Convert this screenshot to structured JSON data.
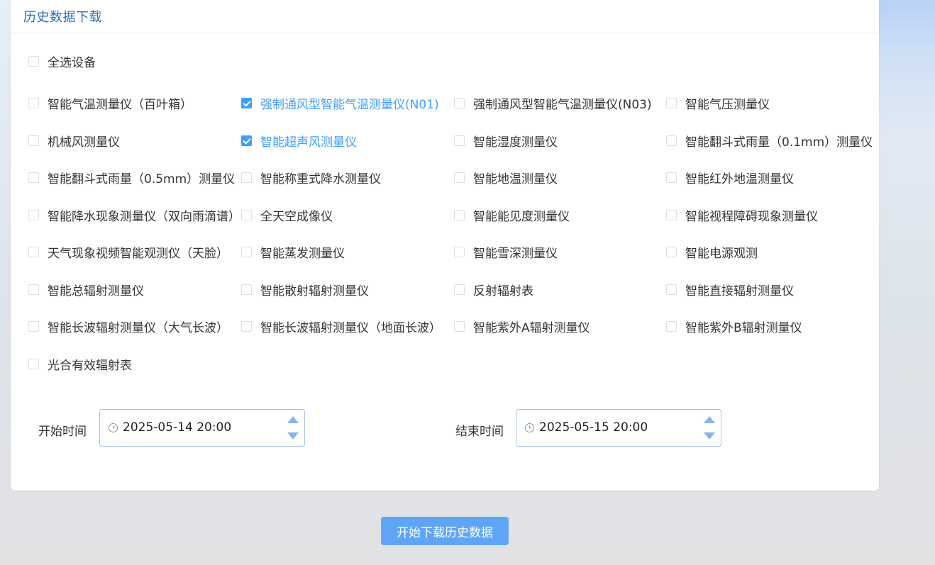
{
  "panel": {
    "title": "历史数据下载"
  },
  "select_all": {
    "label": "全选设备",
    "checked": false
  },
  "devices": [
    {
      "label": "智能气温测量仪（百叶箱）",
      "checked": false
    },
    {
      "label": "强制通风型智能气温测量仪(N01)",
      "checked": true
    },
    {
      "label": "强制通风型智能气温测量仪(N03)",
      "checked": false
    },
    {
      "label": "智能气压测量仪",
      "checked": false
    },
    {
      "label": "机械风测量仪",
      "checked": false
    },
    {
      "label": "智能超声风测量仪",
      "checked": true
    },
    {
      "label": "智能湿度测量仪",
      "checked": false
    },
    {
      "label": "智能翻斗式雨量（0.1mm）测量仪",
      "checked": false
    },
    {
      "label": "智能翻斗式雨量（0.5mm）测量仪",
      "checked": false
    },
    {
      "label": "智能称重式降水测量仪",
      "checked": false
    },
    {
      "label": "智能地温测量仪",
      "checked": false
    },
    {
      "label": "智能红外地温测量仪",
      "checked": false
    },
    {
      "label": "智能降水现象测量仪（双向雨滴谱）",
      "checked": false
    },
    {
      "label": "全天空成像仪",
      "checked": false
    },
    {
      "label": "智能能见度测量仪",
      "checked": false
    },
    {
      "label": "智能视程障碍现象测量仪",
      "checked": false
    },
    {
      "label": "天气现象视频智能观测仪（天脸）",
      "checked": false
    },
    {
      "label": "智能蒸发测量仪",
      "checked": false
    },
    {
      "label": "智能雪深测量仪",
      "checked": false
    },
    {
      "label": "智能电源观测",
      "checked": false
    },
    {
      "label": "智能总辐射测量仪",
      "checked": false
    },
    {
      "label": "智能散射辐射测量仪",
      "checked": false
    },
    {
      "label": "反射辐射表",
      "checked": false
    },
    {
      "label": "智能直接辐射测量仪",
      "checked": false
    },
    {
      "label": "智能长波辐射测量仪（大气长波）",
      "checked": false
    },
    {
      "label": "智能长波辐射测量仪（地面长波）",
      "checked": false
    },
    {
      "label": "智能紫外A辐射测量仪",
      "checked": false
    },
    {
      "label": "智能紫外B辐射测量仪",
      "checked": false
    },
    {
      "label": "光合有效辐射表",
      "checked": false
    }
  ],
  "start_time": {
    "label": "开始时间",
    "value": "2025-05-14 20:00"
  },
  "end_time": {
    "label": "结束时间",
    "value": "2025-05-15 20:00"
  },
  "download_button": {
    "label": "开始下载历史数据"
  },
  "icons": {
    "checkbox_checked": "check-icon",
    "time_field": "clock-icon",
    "spinner_up": "triangle-up-icon",
    "spinner_down": "triangle-down-icon"
  },
  "colors": {
    "title": "#2d6db5",
    "accent": "#409eff",
    "button": "#5ea6f5"
  }
}
